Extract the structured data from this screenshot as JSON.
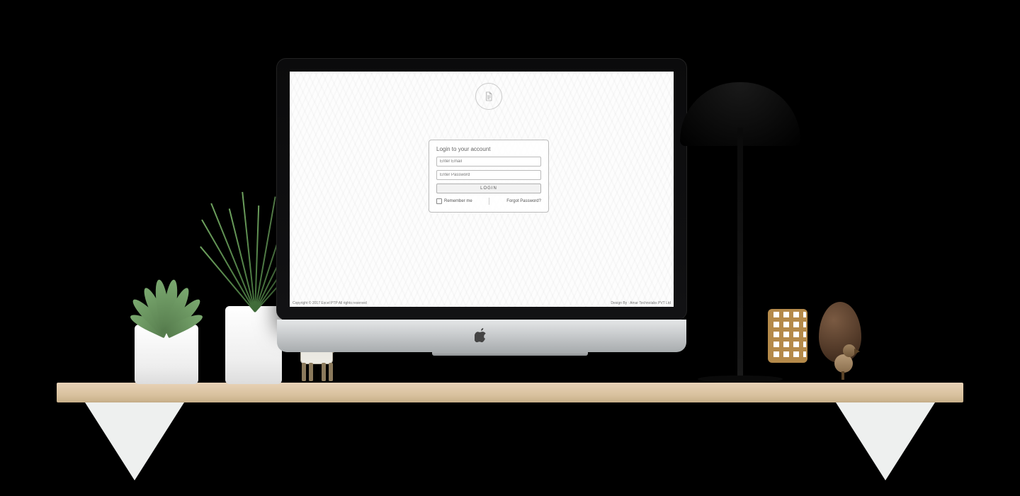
{
  "login": {
    "title": "Login to your account",
    "email_placeholder": "Enter Email",
    "password_placeholder": "Enter Password",
    "button": "LOGIN",
    "remember": "Remember me",
    "forgot": "Forgot Password?"
  },
  "footer": {
    "left": "Copyright © 2017 Excel PTP All rights reserved",
    "right": "Design By : Amar Technolabs PVT Ltd"
  }
}
